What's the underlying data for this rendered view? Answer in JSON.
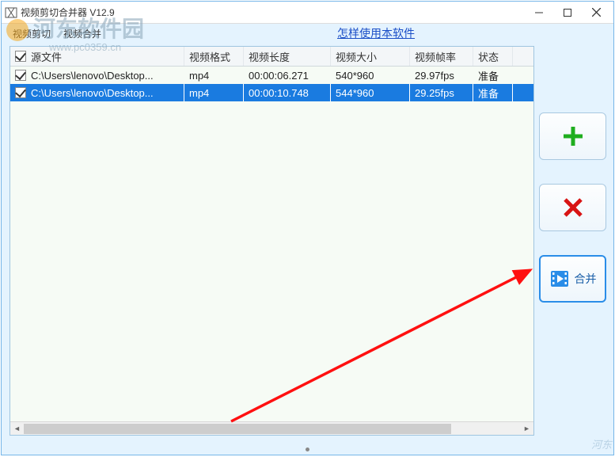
{
  "window": {
    "title": "视频剪切合并器 V12.9"
  },
  "menu": {
    "video_cut": "视频剪切",
    "video_merge": "视频合并",
    "help_link": "怎样使用本软件"
  },
  "table": {
    "headers": {
      "source": "源文件",
      "format": "视频格式",
      "length": "视频长度",
      "size": "视频大小",
      "fps": "视频帧率",
      "status": "状态"
    },
    "rows": [
      {
        "checked": true,
        "selected": false,
        "source": "C:\\Users\\lenovo\\Desktop...",
        "format": "mp4",
        "length": "00:00:06.271",
        "size": "540*960",
        "fps": "29.97fps",
        "status": "准备"
      },
      {
        "checked": true,
        "selected": true,
        "source": "C:\\Users\\lenovo\\Desktop...",
        "format": "mp4",
        "length": "00:00:10.748",
        "size": "544*960",
        "fps": "29.25fps",
        "status": "准备"
      }
    ]
  },
  "side_buttons": {
    "add": "+",
    "remove": "✕",
    "merge_label": "合并"
  },
  "watermark": {
    "text": "河东软件园",
    "url": "www.pc0359.cn"
  }
}
